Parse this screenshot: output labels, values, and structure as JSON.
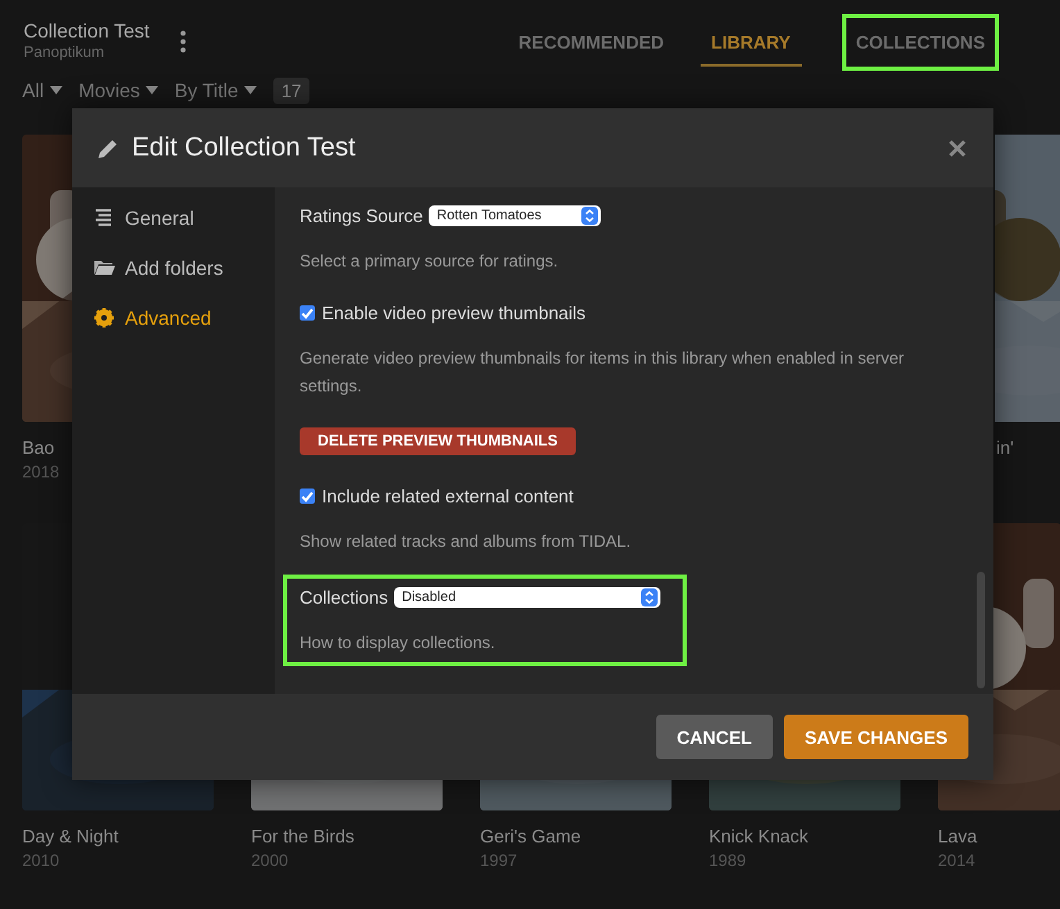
{
  "header": {
    "title": "Collection Test",
    "subtitle": "Panoptikum"
  },
  "tabs": [
    {
      "label": "RECOMMENDED",
      "selected": false,
      "highlighted": false
    },
    {
      "label": "LIBRARY",
      "selected": true,
      "highlighted": false
    },
    {
      "label": "COLLECTIONS",
      "selected": false,
      "highlighted": true
    }
  ],
  "filters": [
    {
      "kind": "dropdown",
      "label": "All"
    },
    {
      "kind": "dropdown",
      "label": "Movies"
    },
    {
      "kind": "dropdown",
      "label": "By Title"
    },
    {
      "kind": "count",
      "label": "17"
    }
  ],
  "poster_rows": [
    [
      {
        "title": "Bao",
        "year": "2018"
      },
      {
        "title": "in'"
      }
    ],
    [
      {
        "title": "Day & Night",
        "year": "2010"
      },
      {
        "title": "For the Birds",
        "year": "2000"
      },
      {
        "title": "Geri's Game",
        "year": "1997"
      },
      {
        "title": "Knick Knack",
        "year": "1989"
      },
      {
        "title": "Lava",
        "year": "2014"
      }
    ]
  ],
  "dialog": {
    "title": "Edit Collection Test",
    "nav": [
      {
        "label": "General",
        "selected": false
      },
      {
        "label": "Add folders",
        "selected": false
      },
      {
        "label": "Advanced",
        "selected": true
      }
    ],
    "settings": [
      {
        "kind": "select",
        "label": "Ratings Source",
        "value": "Rotten Tomatoes",
        "help": "Select a primary source for ratings.",
        "highlighted": false
      },
      {
        "kind": "checkbox",
        "label": "Enable video preview thumbnails",
        "checked": true,
        "help": "Generate video preview thumbnails for items in this library when enabled in server settings."
      },
      {
        "kind": "button",
        "label": "DELETE PREVIEW THUMBNAILS"
      },
      {
        "kind": "checkbox",
        "label": "Include related external content",
        "checked": true,
        "help": "Show related tracks and albums from TIDAL."
      },
      {
        "kind": "select",
        "label": "Collections",
        "value": "Disabled",
        "help": "How to display collections.",
        "highlighted": true
      }
    ],
    "buttons": [
      {
        "kind": "secondary",
        "label": "CANCEL"
      },
      {
        "kind": "primary",
        "label": "SAVE CHANGES"
      }
    ]
  }
}
